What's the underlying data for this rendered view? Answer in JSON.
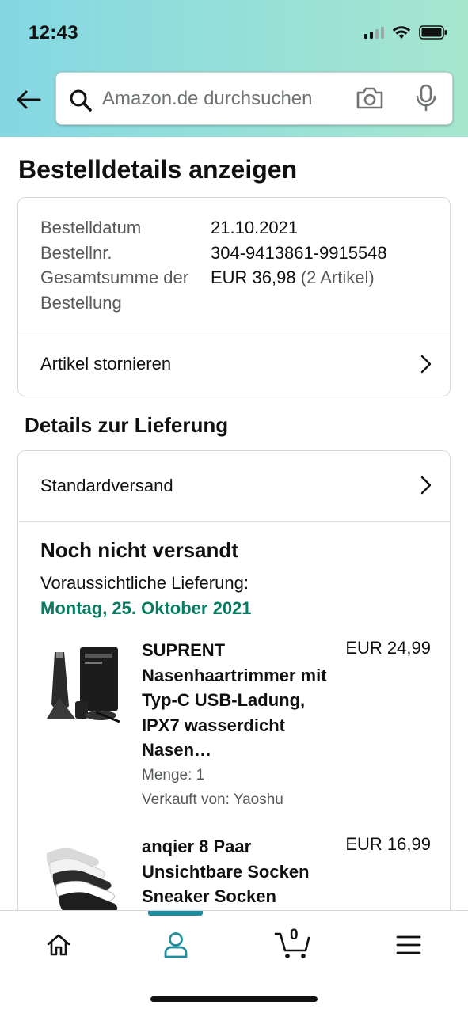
{
  "status_bar": {
    "time": "12:43"
  },
  "search": {
    "placeholder": "Amazon.de durchsuchen"
  },
  "page": {
    "title": "Bestelldetails anzeigen"
  },
  "order": {
    "rows": [
      {
        "label": "Bestelldatum",
        "value": "21.10.2021"
      },
      {
        "label": "Bestellnr.",
        "value": "304-9413861-9915548"
      }
    ],
    "total_label": "Gesamtsumme der Bestellung",
    "total_value": "EUR 36,98",
    "total_items": "(2 Artikel)",
    "cancel_label": "Artikel stornieren"
  },
  "delivery": {
    "section_title": "Details zur Lieferung",
    "shipping_method": "Standardversand",
    "status": "Noch nicht versandt",
    "estimate_label": "Voraussichtliche Lieferung:",
    "estimate_date": "Montag, 25. Oktober 2021"
  },
  "items": [
    {
      "title": "SUPRENT Nasenhaartrimmer mit Typ-C USB-Ladung, IPX7 wasserdicht Nasen…",
      "price": "EUR 24,99",
      "quantity": "Menge: 1",
      "seller": "Verkauft von: Yaoshu"
    },
    {
      "title": "anqier 8 Paar Unsichtbare Socken Sneaker Socken",
      "price": "EUR 16,99"
    }
  ],
  "nav": {
    "cart_count": "0"
  },
  "colors": {
    "header_start": "#84d8e3",
    "header_end": "#a6e6ce",
    "delivery_green": "#067d62",
    "accent": "#1f8d9e"
  }
}
